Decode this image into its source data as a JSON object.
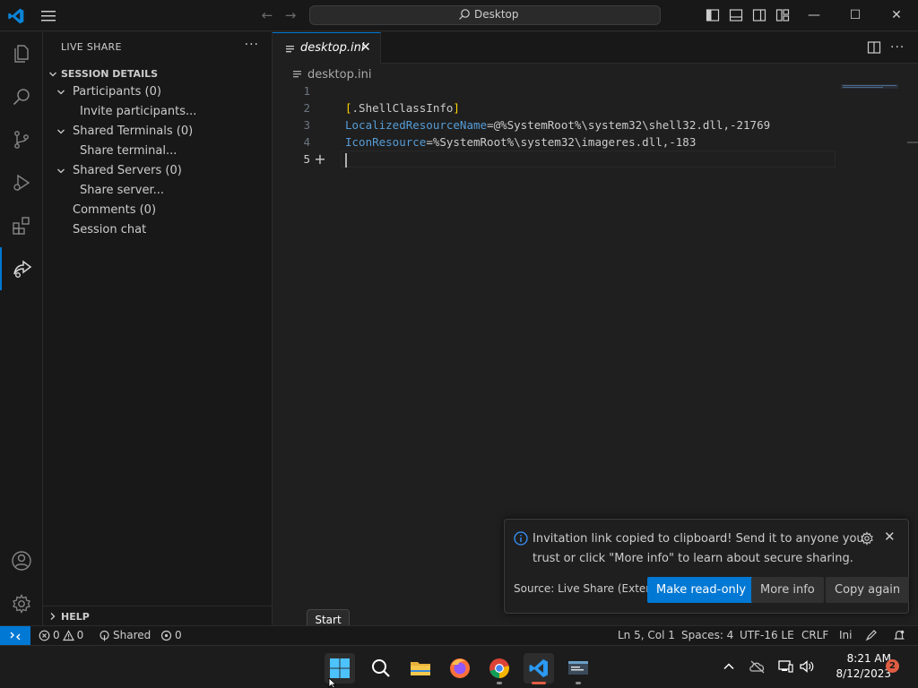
{
  "titlebar": {
    "search_label": "Desktop"
  },
  "sidebar": {
    "title": "LIVE SHARE",
    "more_label": "···",
    "section_label": "SESSION DETAILS",
    "items": [
      {
        "label": "Participants (0)"
      },
      {
        "label": "Invite participants..."
      },
      {
        "label": "Shared Terminals (0)"
      },
      {
        "label": "Share terminal..."
      },
      {
        "label": "Shared Servers (0)"
      },
      {
        "label": "Share server..."
      },
      {
        "label": "Comments (0)"
      },
      {
        "label": "Session chat"
      }
    ],
    "help_label": "HELP"
  },
  "editor": {
    "tab_label": "desktop.ini",
    "tab_close": "✕",
    "breadcrumb": "desktop.ini",
    "lines": [
      {
        "num": "1",
        "text": ""
      },
      {
        "num": "2",
        "bracket_open": "[",
        "section": ".ShellClassInfo",
        "bracket_close": "]"
      },
      {
        "num": "3",
        "key": "LocalizedResourceName",
        "eq": "=",
        "value": "@%SystemRoot%\\system32\\shell32.dll,-21769"
      },
      {
        "num": "4",
        "key": "IconResource",
        "eq": "=",
        "value": "%SystemRoot%\\system32\\imageres.dll,-183"
      },
      {
        "num": "5",
        "text": ""
      }
    ]
  },
  "notification": {
    "message": "Invitation link copied to clipboard! Send it to anyone you trust or click \"More info\" to learn about secure sharing.",
    "source": "Source: Live Share (Exten...",
    "buttons": {
      "make_read_only": "Make read-only",
      "more_info": "More info",
      "copy_again": "Copy again"
    },
    "close": "✕"
  },
  "tooltip": {
    "text": "Start"
  },
  "statusbar": {
    "errors": "0",
    "warnings": "0",
    "shared": "Shared",
    "ports": "0",
    "position": "Ln 5, Col 1",
    "spaces": "Spaces: 4",
    "encoding": "UTF-16 LE",
    "eol": "CRLF",
    "language": "Ini"
  },
  "taskbar": {
    "time": "8:21 AM",
    "date": "8/12/2023",
    "badge": "2"
  },
  "colors": {
    "accent": "#0078d4",
    "keyword": "#569cd6",
    "bracket": "#ffd700",
    "badge": "#e05d44"
  }
}
